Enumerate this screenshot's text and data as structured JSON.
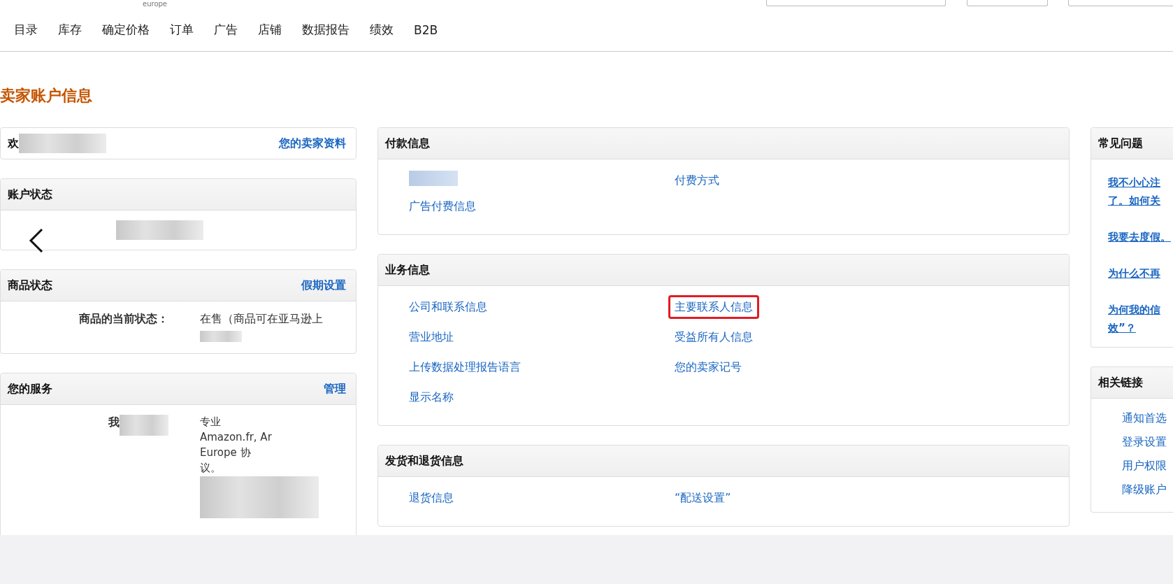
{
  "top_bar": {
    "logo_text": "europe"
  },
  "nav": [
    {
      "label": "目录"
    },
    {
      "label": "库存"
    },
    {
      "label": "确定价格"
    },
    {
      "label": "订单"
    },
    {
      "label": "广告"
    },
    {
      "label": "店铺"
    },
    {
      "label": "数据报告"
    },
    {
      "label": "绩效"
    },
    {
      "label": "B2B"
    }
  ],
  "page_title": "卖家账户信息",
  "left": {
    "welcome": {
      "text": "欢",
      "link": "您的卖家资料"
    },
    "account_status": {
      "title": "账户状态"
    },
    "listing_status": {
      "title": "商品状态",
      "link": "假期设置",
      "label": "商品的当前状态：",
      "value": "在售（商品可在亚马逊上"
    },
    "services": {
      "title": "您的服务",
      "link": "管理",
      "label": "我",
      "lines": [
        "专业",
        "Amazon.fr, Ar",
        "Europe 协",
        "议。"
      ]
    }
  },
  "middle": [
    {
      "title": "付款信息",
      "blurred_first": true,
      "columns": [
        [
          {
            "label": "广告付费信息",
            "highlighted": false
          }
        ],
        [
          {
            "label": "付费方式",
            "highlighted": false
          }
        ]
      ]
    },
    {
      "title": "业务信息",
      "blurred_first": false,
      "columns": [
        [
          {
            "label": "公司和联系信息",
            "highlighted": false
          },
          {
            "label": "营业地址",
            "highlighted": false
          },
          {
            "label": "上传数据处理报告语言",
            "highlighted": false
          },
          {
            "label": "显示名称",
            "highlighted": false
          }
        ],
        [
          {
            "label": "主要联系人信息",
            "highlighted": true
          },
          {
            "label": "受益所有人信息",
            "highlighted": false
          },
          {
            "label": "您的卖家记号",
            "highlighted": false
          }
        ]
      ]
    },
    {
      "title": "发货和退货信息",
      "blurred_first": false,
      "columns": [
        [
          {
            "label": "退货信息",
            "highlighted": false
          }
        ],
        [
          {
            "label": "“配送设置”",
            "highlighted": false
          }
        ]
      ]
    }
  ],
  "right": {
    "faq": {
      "title": "常见问题",
      "items": [
        [
          "我不小心注",
          "了。如何关"
        ],
        [
          "我要去度假。"
        ],
        [
          "为什么不再"
        ],
        [
          "为何我的信",
          "效”？"
        ]
      ]
    },
    "related": {
      "title": "相关链接",
      "links": [
        "通知首选",
        "登录设置",
        "用户权限",
        "降级账户"
      ]
    }
  }
}
